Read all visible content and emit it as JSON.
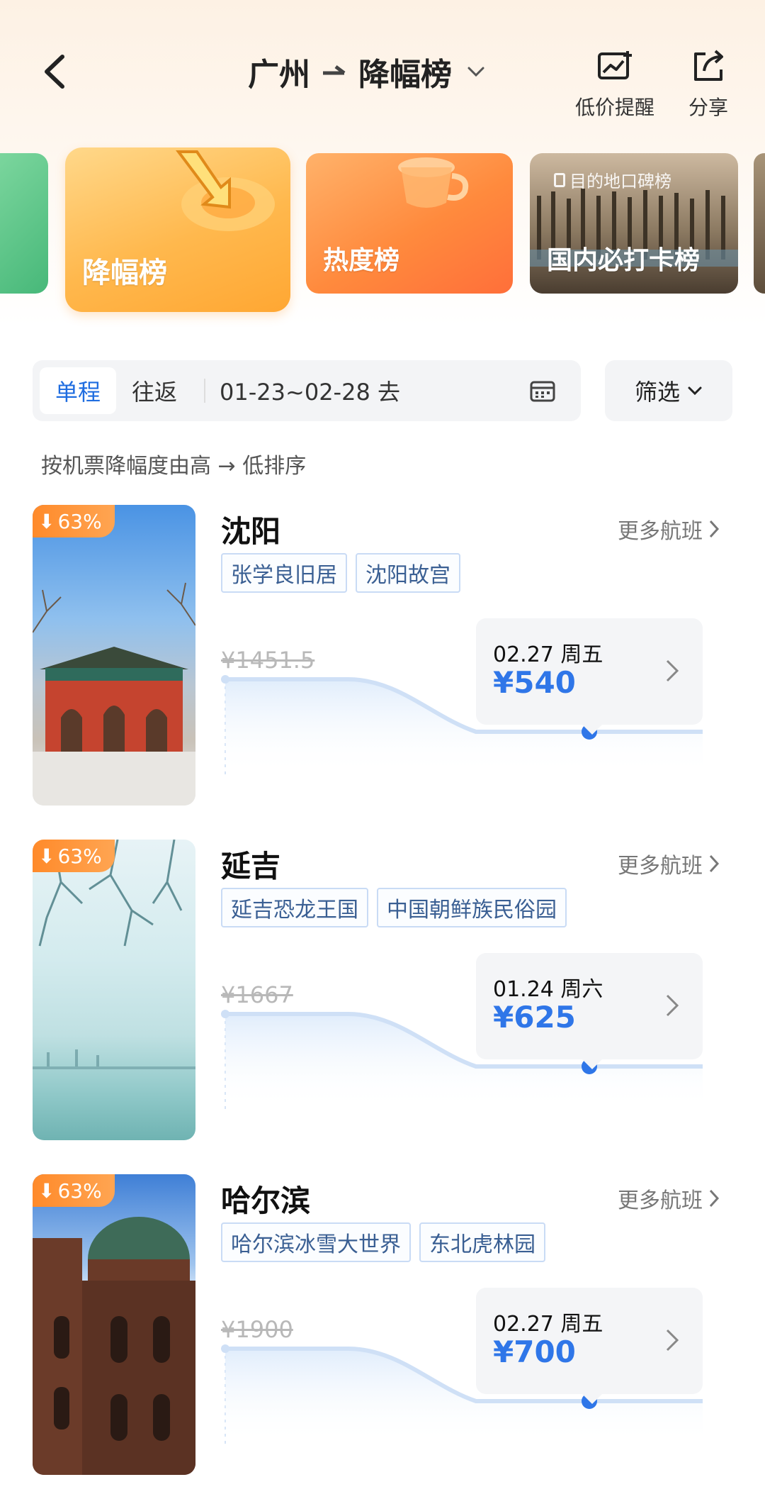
{
  "header": {
    "route_from": "广州",
    "route_to": "降幅榜",
    "alert_label": "低价提醒",
    "share_label": "分享"
  },
  "categories": [
    {
      "label": ""
    },
    {
      "label": "降幅榜"
    },
    {
      "label": "热度榜"
    },
    {
      "label": "国内必打卡榜",
      "tag": "目的地口碑榜"
    }
  ],
  "filters": {
    "oneway": "单程",
    "roundtrip": "往返",
    "dates": "01-23~02-28 去",
    "filter": "筛选"
  },
  "sort_note": "按机票降幅度由高 → 低排序",
  "more_label": "更多航班",
  "items": [
    {
      "badge": "63%",
      "city": "沈阳",
      "tags": [
        "张学良旧居",
        "沈阳故宫"
      ],
      "old_price": "¥1451.5",
      "date": "02.27 周五",
      "price": "¥540"
    },
    {
      "badge": "63%",
      "city": "延吉",
      "tags": [
        "延吉恐龙王国",
        "中国朝鲜族民俗园"
      ],
      "old_price": "¥1667",
      "date": "01.24 周六",
      "price": "¥625"
    },
    {
      "badge": "63%",
      "city": "哈尔滨",
      "tags": [
        "哈尔滨冰雪大世界",
        "东北虎林园"
      ],
      "old_price": "¥1900",
      "date": "02.27 周五",
      "price": "¥700"
    }
  ],
  "colors": {
    "accent_blue": "#2f76e8",
    "badge_orange": "#ff8a2a"
  }
}
